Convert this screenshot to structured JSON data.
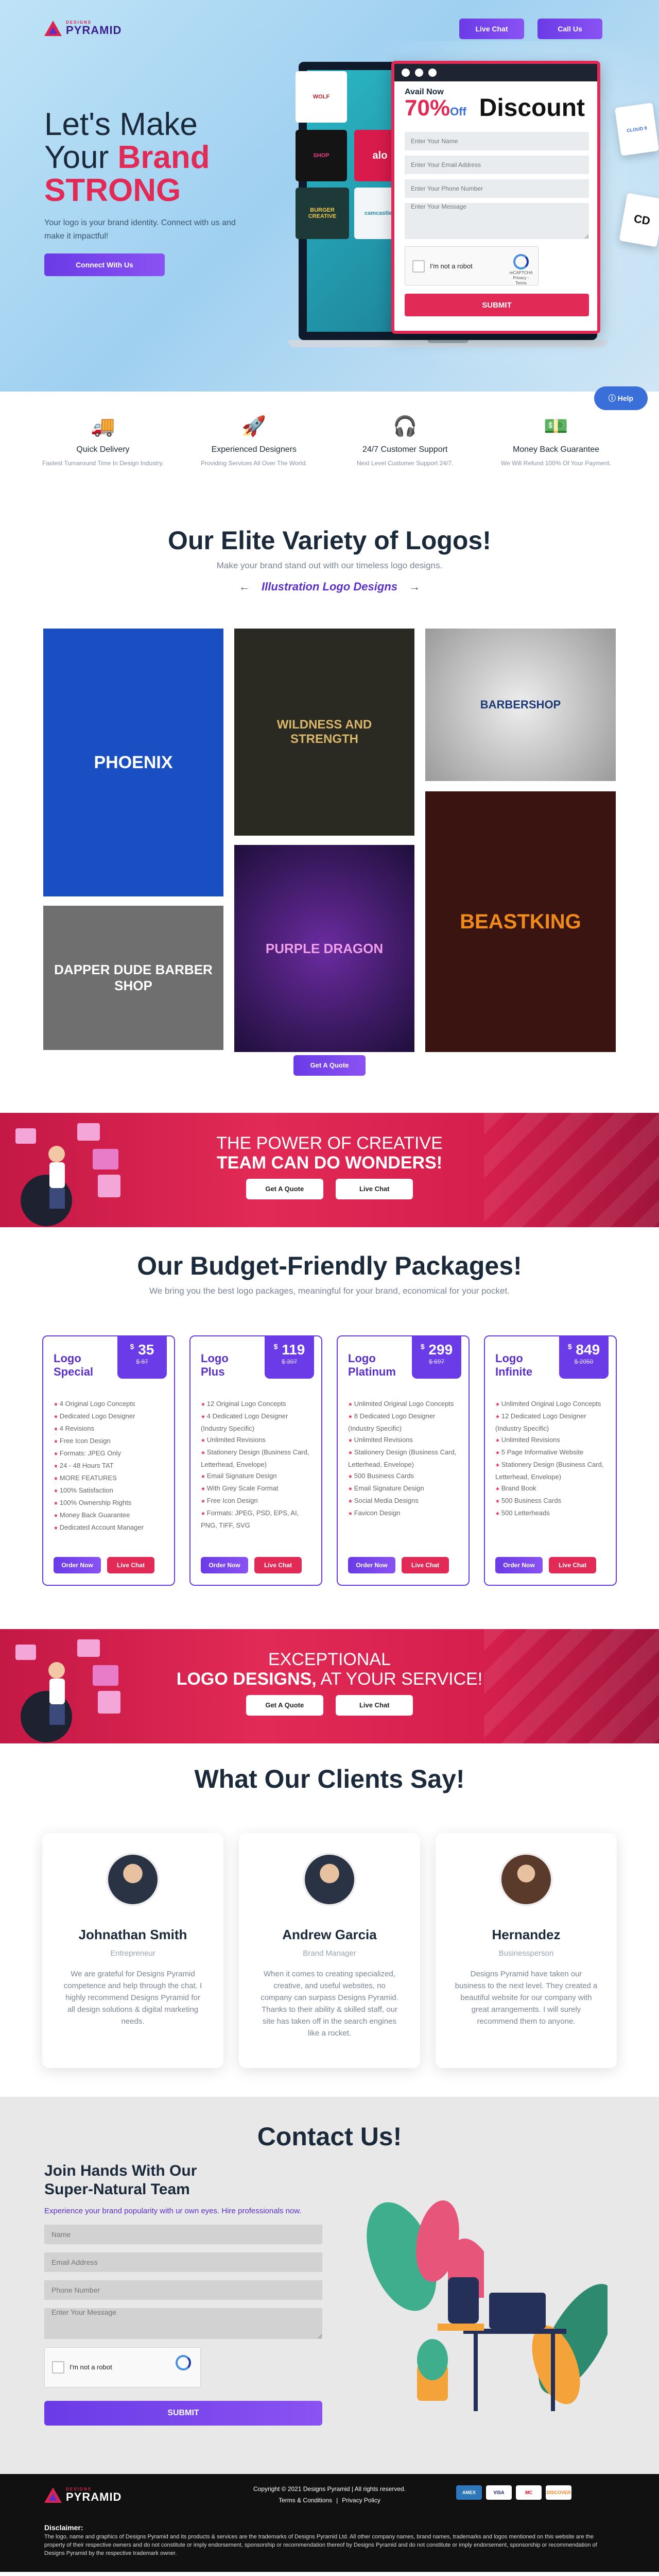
{
  "brand": {
    "name_small": "DESIGNS",
    "name_big": "PYRAMID"
  },
  "header": {
    "live_chat": "Live Chat",
    "call_us": "Call Us"
  },
  "hero": {
    "title_line1": "Let's Make",
    "title_line2_plain": "Your ",
    "title_line2_accent": "Brand",
    "title_line3": "STRONG",
    "subtitle": "Your logo is your brand identity. Connect with us and make it impactful!",
    "cta": "Connect With Us",
    "logo_tiles": [
      "WOLF",
      "SHOP",
      "alo",
      "BURGER CREATIVE",
      "camcastled"
    ],
    "side_cards": [
      "CLOUD 9",
      "CD"
    ]
  },
  "offer_form": {
    "available": "Avail Now",
    "percent": "70%",
    "off": "Off",
    "discount": "Discount",
    "name_placeholder": "Enter Your Name",
    "email_placeholder": "Enter Your Email Address",
    "phone_placeholder": "Enter Your Phone Number",
    "message_placeholder": "Enter Your Message",
    "captcha_label": "I'm not a robot",
    "captcha_brand": "reCAPTCHA",
    "captcha_terms": "Privacy - Terms",
    "submit": "SUBMIT"
  },
  "help_button": "Help",
  "features": [
    {
      "icon": "truck-icon",
      "glyph": "🚚",
      "title": "Quick Delivery",
      "desc": "Fastest Turnaround Time In Design Industry."
    },
    {
      "icon": "rocket-icon",
      "glyph": "🚀",
      "title": "Experienced Designers",
      "desc": "Providing Services All Over The World."
    },
    {
      "icon": "support-agent-icon",
      "glyph": "🎧",
      "title": "24/7 Customer Support",
      "desc": "Next Level Customer Support 24/7."
    },
    {
      "icon": "money-back-icon",
      "glyph": "💵",
      "title": "Money Back Guarantee",
      "desc": "We Will Refund 100% Of Your Payment."
    }
  ],
  "gallery": {
    "title": "Our Elite Variety of Logos!",
    "subtitle": "Make your brand stand out with our timeless logo designs.",
    "category": "Illustration Logo Designs",
    "items": [
      "PHOENIX",
      "WILDNESS AND STRENGTH",
      "BARBERSHOP",
      "DAPPER DUDE BARBER SHOP",
      "PURPLE DRAGON",
      "BEASTKING"
    ],
    "cta": "Get A Quote"
  },
  "banner1": {
    "line1": "THE POWER OF CREATIVE",
    "line2": "TEAM CAN DO WONDERS!",
    "btn_quote": "Get A Quote",
    "btn_chat": "Live Chat"
  },
  "packages": {
    "title": "Our Budget-Friendly Packages!",
    "subtitle": "We bring you the best logo packages, meaningful for your brand, economical for your pocket.",
    "order_label": "Order Now",
    "chat_label": "Live Chat",
    "items": [
      {
        "name1": "Logo",
        "name2": "Special",
        "price": "35",
        "old": "$ 87",
        "features": [
          "4 Original Logo Concepts",
          "Dedicated Logo Designer",
          "4 Revisions",
          "Free Icon Design",
          "Formats: JPEG Only",
          "24 - 48 Hours TAT",
          "MORE FEATURES",
          "100% Satisfaction",
          "100% Ownership Rights",
          "Money Back Guarantee",
          "Dedicated Account Manager"
        ]
      },
      {
        "name1": "Logo",
        "name2": "Plus",
        "price": "119",
        "old": "$ 307",
        "features": [
          "12 Original Logo Concepts",
          "4 Dedicated Logo Designer (Industry Specific)",
          "Unlimited Revisions",
          "Stationery Design (Business Card, Letterhead, Envelope)",
          "Email Signature Design",
          "With Grey Scale Format",
          "Free Icon Design",
          "Formats: JPEG, PSD, EPS, AI, PNG, TIFF, SVG"
        ]
      },
      {
        "name1": "Logo",
        "name2": "Platinum",
        "price": "299",
        "old": "$ 697",
        "features": [
          "Unlimited Original Logo Concepts",
          "8 Dedicated Logo Designer (Industry Specific)",
          "Unlimited Revisions",
          "Stationery Design (Business Card, Letterhead, Envelope)",
          "500 Business Cards",
          "Email Signature Design",
          "Social Media Designs",
          "Favicon Design"
        ]
      },
      {
        "name1": "Logo",
        "name2": "Infinite",
        "price": "849",
        "old": "$ 2050",
        "features": [
          "Unlimited Original Logo Concepts",
          "12 Dedicated Logo Designer (Industry Specific)",
          "Unlimited Revisions",
          "5 Page Informative Website",
          "Stationery Design (Business Card, Letterhead, Envelope)",
          "Brand Book",
          "500 Business Cards",
          "500 Letterheads"
        ]
      }
    ]
  },
  "banner2": {
    "line1": "EXCEPTIONAL",
    "line2_bold": "LOGO DESIGNS,",
    "line2_rest": " AT YOUR SERVICE!",
    "btn_quote": "Get A Quote",
    "btn_chat": "Live Chat"
  },
  "testimonials": {
    "title": "What Our Clients Say!",
    "items": [
      {
        "name": "Johnathan Smith",
        "role": "Entrepreneur",
        "text": "We are grateful for Designs Pyramid competence and help through the chat. I highly recommend Designs Pyramid for all design solutions & digital marketing needs."
      },
      {
        "name": "Andrew Garcia",
        "role": "Brand Manager",
        "text": "When it comes to creating specialized, creative, and useful websites, no company can surpass Designs Pyramid. Thanks to their ability & skilled staff, our site has taken off in the search engines like a rocket."
      },
      {
        "name": "Hernandez",
        "role": "Businessperson",
        "text": "Designs Pyramid have taken our business to the next level. They created a beautiful website for our company with great arrangements. I will surely recommend them to anyone."
      }
    ]
  },
  "contact": {
    "title": "Contact Us!",
    "heading_line1": "Join Hands With Our",
    "heading_line2": "Super-Natural Team",
    "para": "Experience your brand popularity with ur own eyes. Hire professionals now.",
    "name_placeholder": "Name",
    "email_placeholder": "Email Address",
    "phone_placeholder": "Phone Number",
    "message_placeholder": "Enter Your Message",
    "captcha_label": "I'm not a robot",
    "submit": "SUBMIT"
  },
  "footer": {
    "copyright": "Copyright © 2021 Designs Pyramid | All rights reserved.",
    "terms": "Terms & Conditions",
    "privacy": "Privacy Policy",
    "payments": [
      "AMEX",
      "VISA",
      "MC",
      "DISCOVER"
    ],
    "disclaimer_title": "Disclaimer:",
    "disclaimer_text": "The logo, name and graphics of Designs Pyramid and its products & services are the trademarks of Designs Pyramid Ltd. All other company names, brand names, trademarks and logos mentioned on this website are the property of their respective owners and do not constitute or imply endorsement, sponsorship or recommendation thereof by Designs Pyramid and do not constitute or imply endorsement, sponsorship or recommendation of Designs Pyramid by the respective trademark owner."
  }
}
